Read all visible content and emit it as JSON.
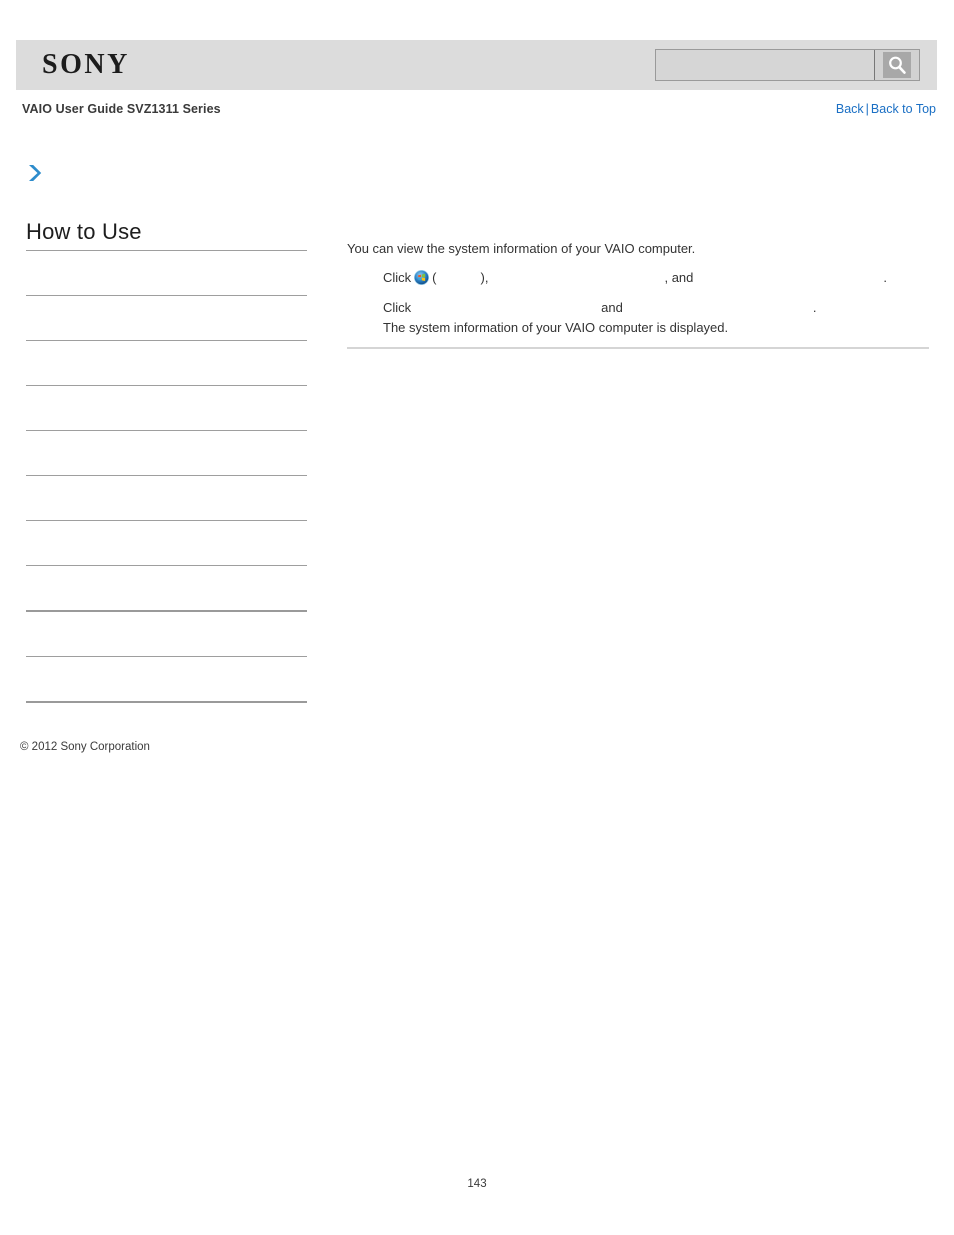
{
  "header": {
    "logo_text": "SONY",
    "search": {
      "value": "",
      "placeholder": "",
      "button_icon": "search-icon"
    }
  },
  "breadcrumb": {
    "doc_title": "VAIO User Guide SVZ1311 Series",
    "nav": {
      "back_label": "Back",
      "separator": "|",
      "back_to_top_label": "Back to Top"
    }
  },
  "sidebar": {
    "expand_icon": "chevron-right-icon",
    "title": "How to Use",
    "items": [
      {
        "label": ""
      },
      {
        "label": ""
      },
      {
        "label": ""
      },
      {
        "label": ""
      },
      {
        "label": ""
      },
      {
        "label": ""
      },
      {
        "label": ""
      },
      {
        "label": ""
      },
      {
        "label": ""
      },
      {
        "label": ""
      }
    ],
    "copyright": "© 2012 Sony Corporation"
  },
  "main": {
    "intro": "You can view the system information of your VAIO computer.",
    "steps": [
      {
        "prefix": "Click",
        "icon": "windows-start-orb-icon",
        "open_paren": "(",
        "close_paren": "),",
        "comma_and": ", and",
        "period": "."
      },
      {
        "prefix": "Click",
        "and": "and",
        "period": "."
      },
      {
        "text": "The system information of your VAIO computer is displayed."
      }
    ]
  },
  "footer": {
    "page_number": "143"
  },
  "colors": {
    "header_bg": "#dcdcdc",
    "link_blue": "#1a6fc4",
    "rule_gray": "#9e9e9e",
    "content_rule": "#d5d5d5",
    "text": "#333333"
  }
}
